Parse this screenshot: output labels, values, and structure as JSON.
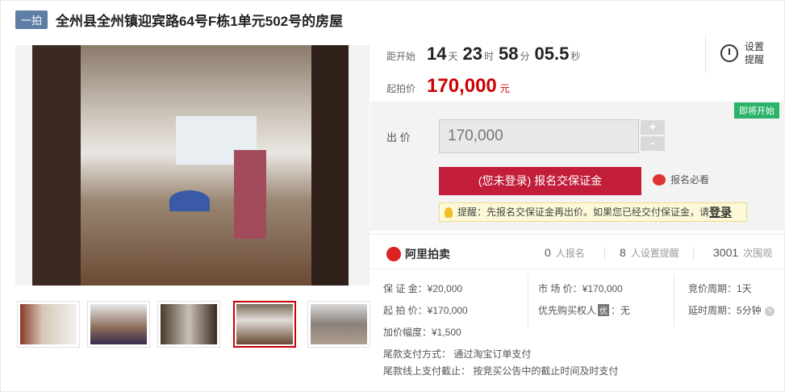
{
  "header": {
    "tag": "一拍",
    "title": "全州县全州镇迎宾路64号F栋1单元502号的房屋"
  },
  "gallery": {
    "thumb_count": 5,
    "active_thumb": 4
  },
  "countdown": {
    "label": "距开始",
    "days": "14",
    "days_unit": "天",
    "hours": "23",
    "hours_unit": "时",
    "minutes": "58",
    "minutes_unit": "分",
    "seconds": "05.5",
    "seconds_unit": "秒"
  },
  "remind": {
    "label_line1": "设置",
    "label_line2": "提醒"
  },
  "start_price": {
    "label": "起拍价",
    "value": "170,000",
    "unit": "元"
  },
  "bid": {
    "status_badge": "即将开始",
    "label": "出 价",
    "value": "170,000",
    "plus": "+",
    "minus": "-",
    "signup_button": "(您未登录) 报名交保证金",
    "must_read": "报名必看",
    "hint_text": "提醒：先报名交保证金再出价。如果您已经交付保证金，请",
    "hint_login": "登录"
  },
  "stats": {
    "brand": "阿里拍卖",
    "signups": "0",
    "signups_unit": "人报名",
    "reminders": "8",
    "reminders_unit": "人设置提醒",
    "views": "3001",
    "views_unit": "次围观"
  },
  "details": {
    "deposit": "保 证 金：¥20,000",
    "market_price": "市 场 价：¥170,000",
    "bid_cycle": "竞价周期：1天",
    "start_price": "起 拍 价：¥170,000",
    "priority_label": "优先购买权人",
    "priority_badge": "优",
    "priority_value": "：无",
    "delay_cycle": "延时周期：5分钟",
    "increment": "加价幅度：¥1,500",
    "payment_method": "尾款支付方式： 通过淘宝订单支付",
    "payment_deadline": "尾款线上支付截止： 按竞买公告中的截止时间及时支付"
  }
}
